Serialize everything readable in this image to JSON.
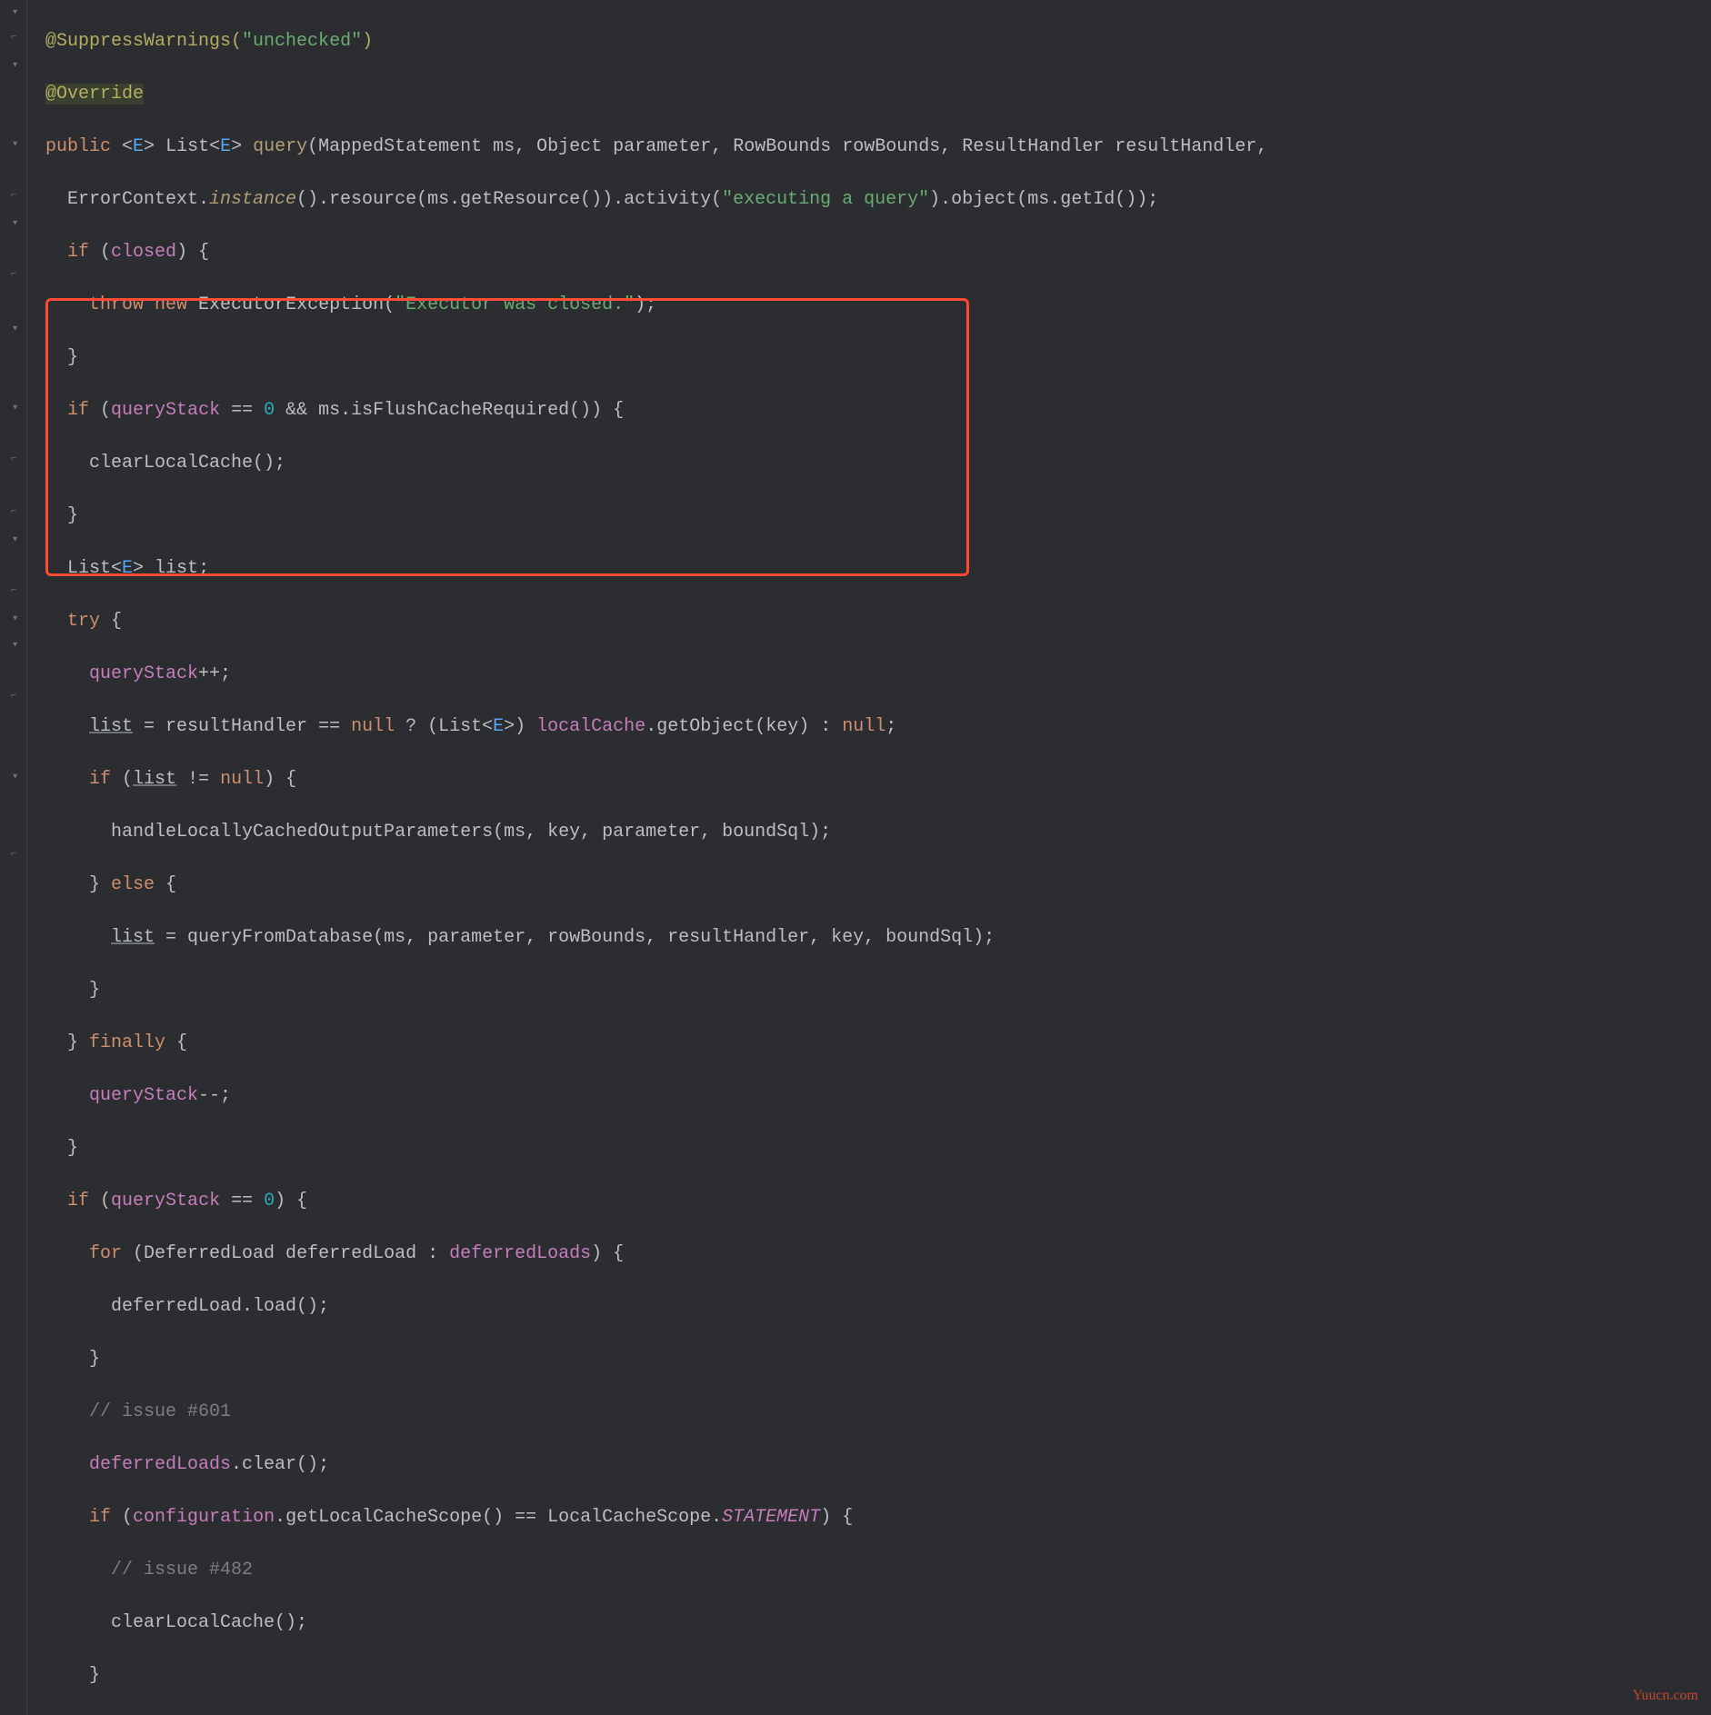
{
  "watermark": "Yuucn.com",
  "code": {
    "l01_pre": "@SuppressWarnings(",
    "l01_str": "\"unchecked\"",
    "l01_post": ")",
    "l02": "@Override",
    "l03_kw1": "public",
    "l03_gen": " <",
    "l03_E": "E",
    "l03_gen2": "> ",
    "l03_List": "List<",
    "l03_E2": "E",
    "l03_gt": "> ",
    "l03_query": "query",
    "l03_sig": "(MappedStatement ms, Object parameter, RowBounds rowBounds, ResultHandler resultHandler, ",
    "l04_a": "  ErrorContext.",
    "l04_inst": "instance",
    "l04_b": "().resource(ms.getResource()).activity(",
    "l04_str": "\"executing a query\"",
    "l04_c": ").object(ms.getId());",
    "l05_a": "  ",
    "l05_if": "if",
    "l05_b": " (",
    "l05_closed": "closed",
    "l05_c": ") {",
    "l06_a": "    ",
    "l06_throw": "throw new",
    "l06_b": " ExecutorException(",
    "l06_str": "\"Executor was closed.\"",
    "l06_c": ");",
    "l07": "  }",
    "l08_a": "  ",
    "l08_if": "if",
    "l08_b": " (",
    "l08_qs": "queryStack",
    "l08_c": " == ",
    "l08_zero": "0",
    "l08_d": " && ms.isFlushCacheRequired()) {",
    "l09": "    clearLocalCache();",
    "l10": "  }",
    "l11_a": "  List<",
    "l11_E": "E",
    "l11_b": "> ",
    "l11_list": "list",
    "l11_c": ";",
    "l12_a": "  ",
    "l12_try": "try",
    "l12_b": " {",
    "l13_a": "    ",
    "l13_qs": "queryStack",
    "l13_b": "++;",
    "l14_a": "    ",
    "l14_list": "list",
    "l14_b": " = resultHandler == ",
    "l14_null": "null",
    "l14_c": " ? (List<",
    "l14_E": "E",
    "l14_d": ">) ",
    "l14_lc": "localCache",
    "l14_e": ".getObject(key) : ",
    "l14_null2": "null",
    "l14_f": ";",
    "l15_a": "    ",
    "l15_if": "if",
    "l15_b": " (",
    "l15_list": "list",
    "l15_c": " != ",
    "l15_null": "null",
    "l15_d": ") {",
    "l16": "      handleLocallyCachedOutputParameters(ms, key, parameter, boundSql);",
    "l17_a": "    } ",
    "l17_else": "else",
    "l17_b": " {",
    "l18_a": "      ",
    "l18_list": "list",
    "l18_b": " = queryFromDatabase(ms, parameter, rowBounds, resultHandler, key, boundSql);",
    "l19": "    }",
    "l20_a": "  } ",
    "l20_fin": "finally",
    "l20_b": " {",
    "l21_a": "    ",
    "l21_qs": "queryStack",
    "l21_b": "--;",
    "l22": "  }",
    "l23_a": "  ",
    "l23_if": "if",
    "l23_b": " (",
    "l23_qs": "queryStack",
    "l23_c": " == ",
    "l23_zero": "0",
    "l23_d": ") {",
    "l24_a": "    ",
    "l24_for": "for",
    "l24_b": " (DeferredLoad deferredLoad : ",
    "l24_dl": "deferredLoads",
    "l24_c": ") {",
    "l25": "      deferredLoad.load();",
    "l26": "    }",
    "l27_a": "    ",
    "l27_c": "// issue #601",
    "l28_a": "    ",
    "l28_dl": "deferredLoads",
    "l28_b": ".clear();",
    "l29_a": "    ",
    "l29_if": "if",
    "l29_b": " (",
    "l29_cfg": "configuration",
    "l29_c": ".getLocalCacheScope() == LocalCacheScope.",
    "l29_stmt": "STATEMENT",
    "l29_d": ") {",
    "l30_a": "      ",
    "l30_c": "// issue #482",
    "l31": "      clearLocalCache();",
    "l32": "    }"
  }
}
